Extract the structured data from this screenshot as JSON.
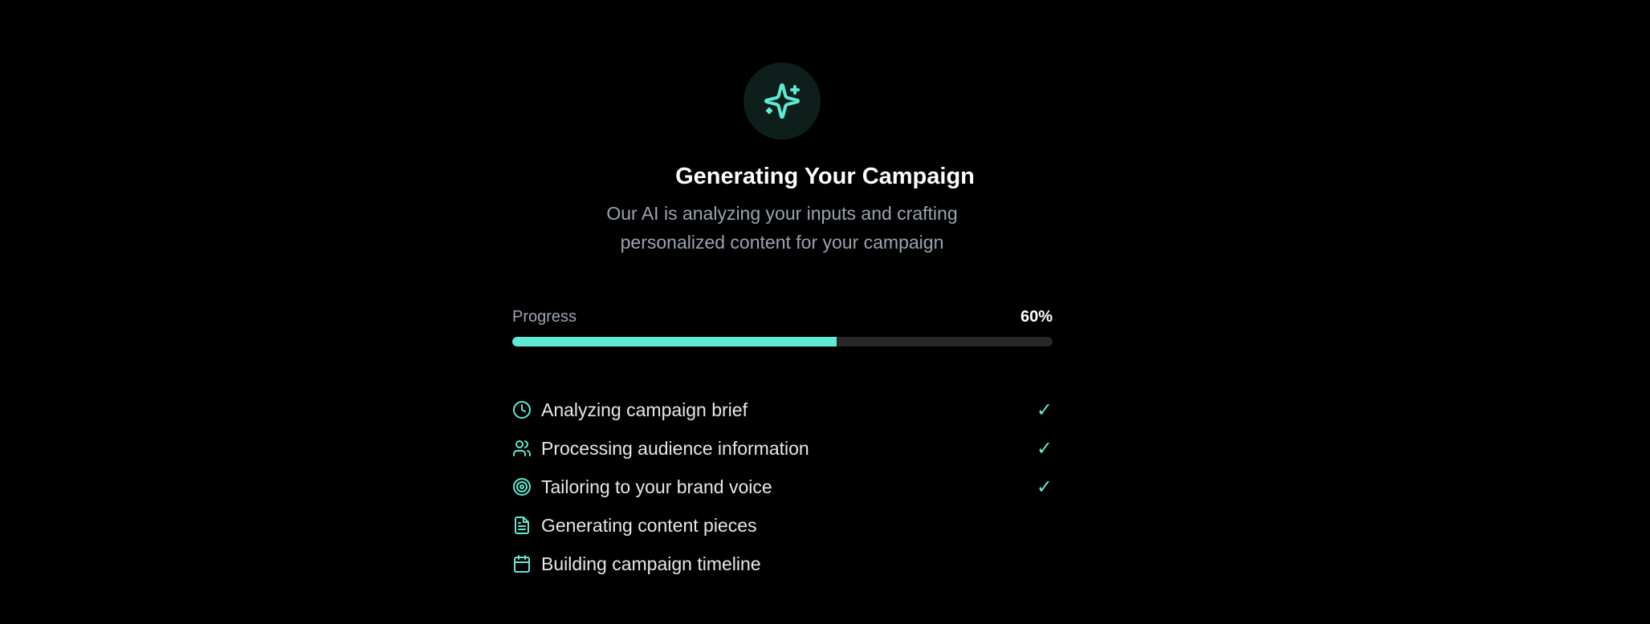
{
  "header": {
    "icon": "sparkles-icon",
    "title": "Generating Your Campaign",
    "subtitle": "Our AI is analyzing your inputs and crafting personalized content for your campaign"
  },
  "progress": {
    "label": "Progress",
    "value_text": "60%",
    "value": 60
  },
  "steps": [
    {
      "icon": "clock-icon",
      "label": "Analyzing campaign brief",
      "done": true,
      "check": "✓"
    },
    {
      "icon": "users-icon",
      "label": "Processing audience information",
      "done": true,
      "check": "✓"
    },
    {
      "icon": "target-icon",
      "label": "Tailoring to your brand voice",
      "done": true,
      "check": "✓"
    },
    {
      "icon": "document-icon",
      "label": "Generating content pieces",
      "done": false,
      "check": ""
    },
    {
      "icon": "calendar-icon",
      "label": "Building campaign timeline",
      "done": false,
      "check": ""
    }
  ],
  "colors": {
    "background": "#000000",
    "accent": "#5eead4",
    "icon_circle": "#0d1e1b",
    "muted_text": "#9ca3af",
    "track": "#27272a"
  }
}
